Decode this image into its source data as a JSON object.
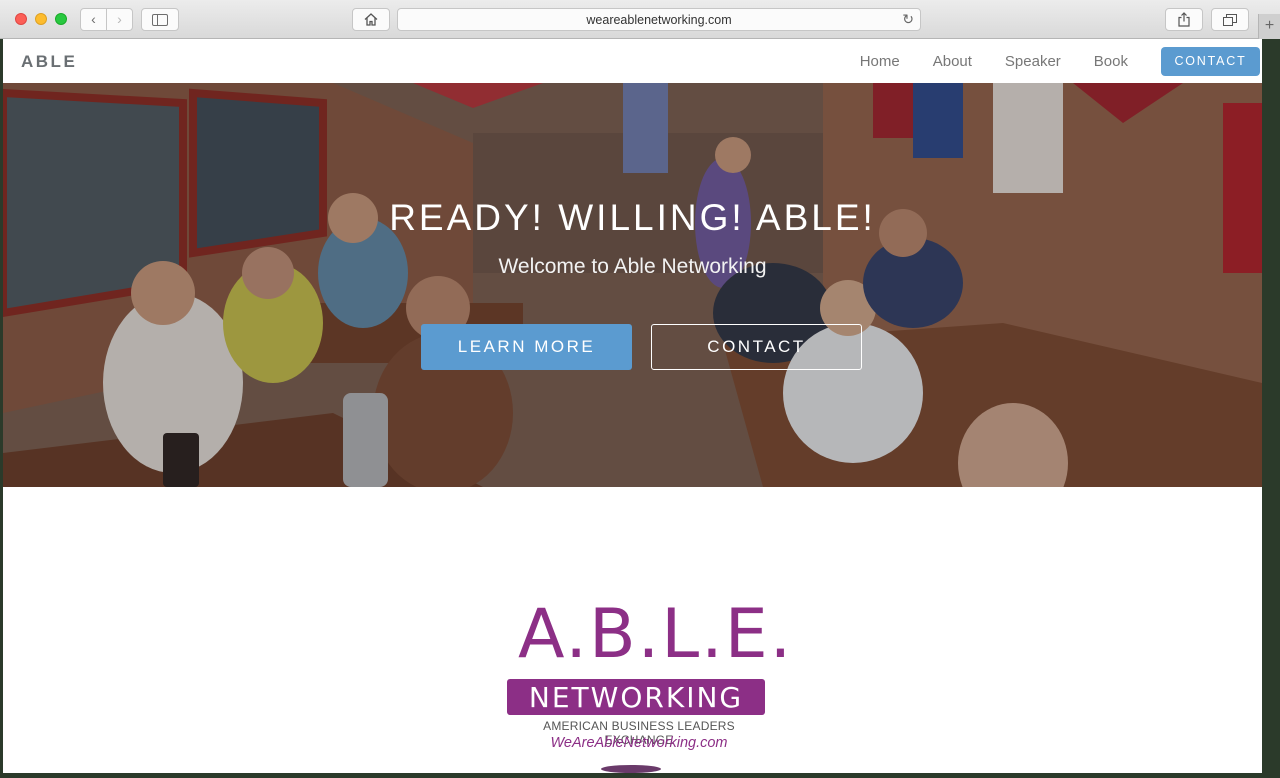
{
  "browser": {
    "url": "weareablenetworking.com",
    "back_glyph": "‹",
    "forward_glyph": "›",
    "reload_glyph": "↻",
    "newtab_glyph": "+",
    "icons": [
      "back-icon",
      "forward-icon",
      "sidebar-icon",
      "home-icon",
      "reload-icon",
      "share-icon",
      "tabs-icon",
      "plus-icon"
    ]
  },
  "navbar": {
    "brand": "ABLE",
    "links": [
      "Home",
      "About",
      "Speaker",
      "Book"
    ],
    "contact_label": "CONTACT"
  },
  "hero": {
    "title": "READY! WILLING! ABLE!",
    "subtitle": "Welcome to Able Networking",
    "learn_more_label": "LEARN MORE",
    "contact_label": "CONTACT"
  },
  "logo": {
    "main": "A.B.L.E.",
    "bar": "NETWORKING",
    "tagline": "AMERICAN BUSINESS LEADERS EXCHANGE",
    "url": "WeAreAbleNetworking.com"
  },
  "colors": {
    "accent": "#5b9bd0",
    "brand_purple": "#8c2f86"
  }
}
